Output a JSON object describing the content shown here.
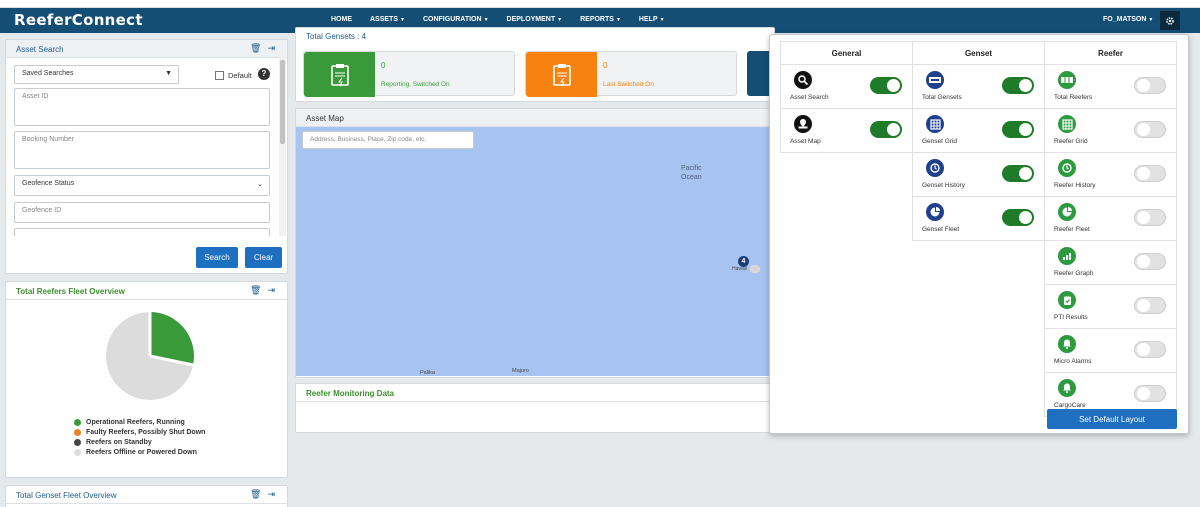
{
  "app": {
    "brand": "ReeferConnect",
    "user": "FO_MATSON"
  },
  "nav": [
    {
      "label": "HOME",
      "caret": false
    },
    {
      "label": "ASSETS",
      "caret": true
    },
    {
      "label": "CONFIGURATION",
      "caret": true
    },
    {
      "label": "DEPLOYMENT",
      "caret": true
    },
    {
      "label": "REPORTS",
      "caret": true
    },
    {
      "label": "HELP",
      "caret": true
    }
  ],
  "asset_search": {
    "title": "Asset Search",
    "saved_searches": "Saved Searches",
    "default_label": "Default",
    "asset_id_placeholder": "Asset ID",
    "booking_placeholder": "Booking Number",
    "geofence_status": "Geofence Status",
    "geofence_id_placeholder": "Geofence ID",
    "search_btn": "Search",
    "clear_btn": "Clear"
  },
  "reefer_fleet": {
    "title": "Total Reefers Fleet Overview",
    "legend": [
      {
        "label": "Operational Reefers, Running",
        "color": "#3a9a3a"
      },
      {
        "label": "Faulty Reefers, Possibly Shut Down",
        "color": "#f08020"
      },
      {
        "label": "Reefers on Standby",
        "color": "#444444"
      },
      {
        "label": "Reefers Offline or Powered Down",
        "color": "#dddddd"
      }
    ]
  },
  "genset_fleet": {
    "title": "Total Genset Fleet Overview"
  },
  "gensets": {
    "title": "Total Gensets : 4",
    "cards": [
      {
        "value": "0",
        "label": "Reporting, Switched On",
        "color": "#3a9a3a"
      },
      {
        "value": "0",
        "label": "Last Switched On",
        "color": "#f7820f"
      }
    ]
  },
  "asset_map": {
    "title": "Asset Map",
    "search_placeholder": "Address, Business, Place, Zip code, etc.",
    "ocean_label_1": "Pacific",
    "ocean_label_2": "Ocean",
    "cluster_count": "4",
    "hawaii_label": "Hawaii",
    "place_1": "Palika",
    "place_2": "Majuro"
  },
  "reefer_monitoring": {
    "title": "Reefer Monitoring Data"
  },
  "layout_settings": {
    "columns": [
      {
        "title": "General",
        "items": [
          {
            "label": "Asset Search",
            "icon": "search-icon",
            "on": true
          },
          {
            "label": "Asset Map",
            "icon": "map-icon",
            "on": true
          }
        ]
      },
      {
        "title": "Genset",
        "items": [
          {
            "label": "Total Gensets",
            "icon": "genset-icon",
            "on": true
          },
          {
            "label": "Genset Grid",
            "icon": "grid-icon",
            "on": true
          },
          {
            "label": "Genset History",
            "icon": "history-icon",
            "on": true
          },
          {
            "label": "Genset Fleet",
            "icon": "pie-icon",
            "on": true
          }
        ]
      },
      {
        "title": "Reefer",
        "items": [
          {
            "label": "Total Reefers",
            "icon": "reefer-icon",
            "on": false
          },
          {
            "label": "Reefer Grid",
            "icon": "grid-icon",
            "on": false
          },
          {
            "label": "Reefer History",
            "icon": "history-icon",
            "on": false
          },
          {
            "label": "Reefer Fleet",
            "icon": "pie-icon",
            "on": false
          },
          {
            "label": "Reefer Graph",
            "icon": "graph-icon",
            "on": false
          },
          {
            "label": "PTI Results",
            "icon": "clipboard-icon",
            "on": false
          },
          {
            "label": "Micro Alarms",
            "icon": "bell-icon",
            "on": false
          },
          {
            "label": "CargoCare",
            "icon": "bell-icon",
            "on": false
          }
        ]
      }
    ],
    "default_button": "Set Default Layout"
  }
}
